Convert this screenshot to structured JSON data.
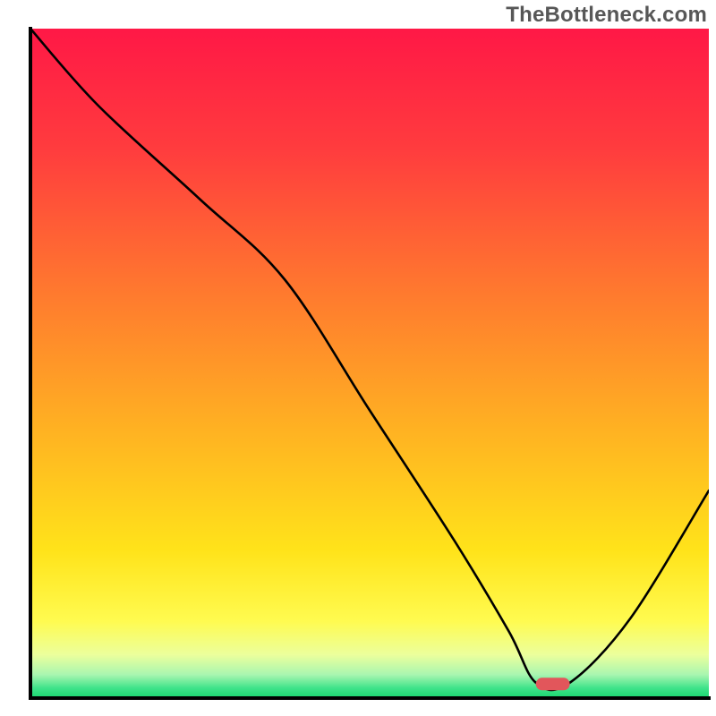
{
  "watermark": "TheBottleneck.com",
  "chart_data": {
    "type": "line",
    "title": "",
    "xlabel": "",
    "ylabel": "",
    "xlim": [
      0,
      100
    ],
    "ylim": [
      0,
      100
    ],
    "grid": false,
    "annotations": [],
    "series": [
      {
        "name": "curve",
        "x": [
          0,
          10,
          25,
          37.5,
          50,
          62.5,
          70.5,
          74.5,
          79.5,
          88.5,
          100
        ],
        "y": [
          100,
          88.5,
          74.5,
          62.5,
          43,
          23.5,
          10,
          2.3,
          2.3,
          12,
          31
        ]
      }
    ],
    "marker": {
      "x_start": 74.5,
      "x_end": 79.5,
      "y": 2.1
    },
    "gradient_stops": [
      {
        "offset": 0.0,
        "color": "#ff1846"
      },
      {
        "offset": 0.18,
        "color": "#ff3c3e"
      },
      {
        "offset": 0.4,
        "color": "#ff7b2e"
      },
      {
        "offset": 0.6,
        "color": "#ffb222"
      },
      {
        "offset": 0.78,
        "color": "#ffe31a"
      },
      {
        "offset": 0.885,
        "color": "#fffb50"
      },
      {
        "offset": 0.935,
        "color": "#ecff9c"
      },
      {
        "offset": 0.965,
        "color": "#a9f6b0"
      },
      {
        "offset": 0.985,
        "color": "#3fe38a"
      },
      {
        "offset": 1.0,
        "color": "#18d66f"
      }
    ],
    "axis_color": "#000000",
    "curve_color": "#000000",
    "marker_color": "#e2565b"
  }
}
